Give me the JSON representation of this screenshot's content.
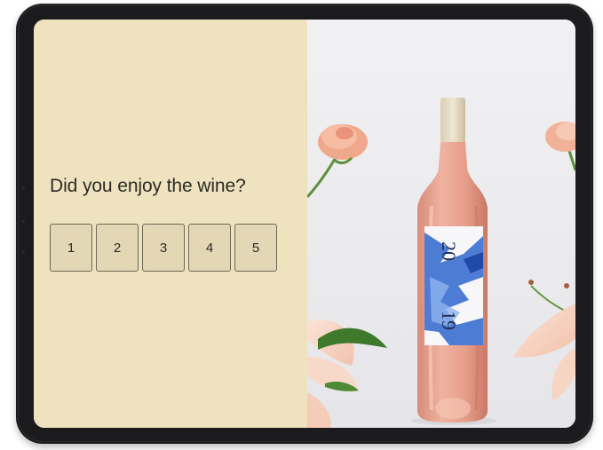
{
  "survey": {
    "question": "Did you enjoy the wine?",
    "options": [
      "1",
      "2",
      "3",
      "4",
      "5"
    ]
  },
  "product_image": {
    "subject": "rosé wine bottle with flowers",
    "label_digits_top": "20",
    "label_digits_bottom": "19"
  },
  "colors": {
    "panel_background": "#efe2be",
    "button_fill": "#e3d7b6",
    "button_border": "#6f6756",
    "text": "#2b2a26",
    "wine": "#e7a48f",
    "label_blue": "#2f5fc4"
  }
}
